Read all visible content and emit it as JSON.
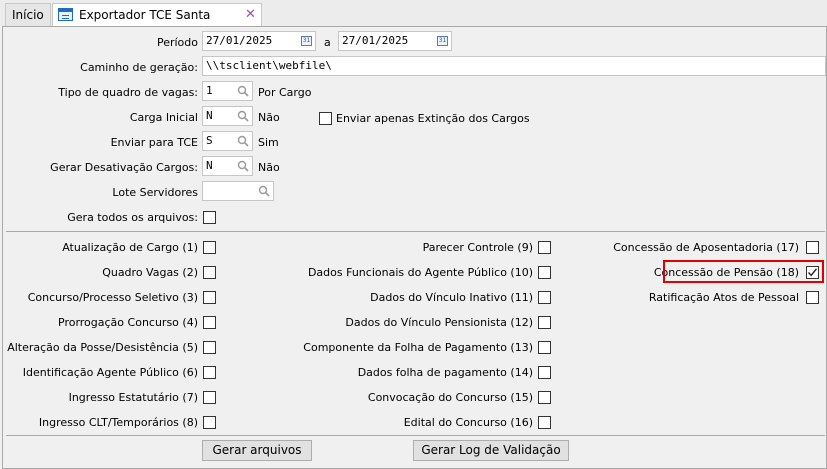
{
  "tabs": [
    {
      "label": "Início"
    },
    {
      "label": "Exportador TCE Santa Catarina",
      "close": "✕"
    }
  ],
  "form": {
    "periodo_label": "Período",
    "periodo_inicio": "27/01/2025",
    "periodo_a": "a",
    "periodo_fim": "27/01/2025",
    "caminho_label": "Caminho de geração:",
    "caminho_value": "\\\\tsclient\\webfile\\",
    "tipo_quadro_label": "Tipo de quadro de vagas:",
    "tipo_quadro_value": "1",
    "tipo_quadro_desc": "Por Cargo",
    "carga_inicial_label": "Carga Inicial",
    "carga_inicial_value": "N",
    "carga_inicial_desc": "Não",
    "enviar_extincao_label": "Enviar apenas Extinção dos Cargos",
    "enviar_tce_label": "Enviar para TCE",
    "enviar_tce_value": "S",
    "enviar_tce_desc": "Sim",
    "gerar_desativacao_label": "Gerar Desativação Cargos:",
    "gerar_desativacao_value": "N",
    "gerar_desativacao_desc": "Não",
    "lote_servidores_label": "Lote Servidores",
    "lote_servidores_value": "",
    "gera_todos_label": "Gera todos os arquivos:"
  },
  "files_col1": [
    {
      "label": "Atualização de Cargo (1)",
      "checked": false
    },
    {
      "label": "Quadro Vagas (2)",
      "checked": false
    },
    {
      "label": "Concurso/Processo Seletivo (3)",
      "checked": false
    },
    {
      "label": "Prorrogação Concurso (4)",
      "checked": false
    },
    {
      "label": "Alteração da Posse/Desistência (5)",
      "checked": false
    },
    {
      "label": "Identificação Agente Público (6)",
      "checked": false
    },
    {
      "label": "Ingresso Estatutário (7)",
      "checked": false
    },
    {
      "label": "Ingresso CLT/Temporários (8)",
      "checked": false
    }
  ],
  "files_col2": [
    {
      "label": "Parecer Controle (9)",
      "checked": false
    },
    {
      "label": "Dados Funcionais do Agente Público (10)",
      "checked": false
    },
    {
      "label": "Dados do Vínculo Inativo (11)",
      "checked": false
    },
    {
      "label": "Dados do Vínculo Pensionista (12)",
      "checked": false
    },
    {
      "label": "Componente da Folha de Pagamento (13)",
      "checked": false
    },
    {
      "label": "Dados folha de pagamento (14)",
      "checked": false
    },
    {
      "label": "Convocação do Concurso (15)",
      "checked": false
    },
    {
      "label": "Edital do Concurso (16)",
      "checked": false
    }
  ],
  "files_col3": [
    {
      "label": "Concessão de Aposentadoria (17)",
      "checked": false
    },
    {
      "label": "Concessão de Pensão (18)",
      "checked": true
    },
    {
      "label": "Ratificação Atos de Pessoal",
      "checked": false
    }
  ],
  "buttons": {
    "gerar_arquivos": "Gerar arquivos",
    "gerar_log": "Gerar Log de Validação"
  },
  "highlight_color": "#e00000"
}
